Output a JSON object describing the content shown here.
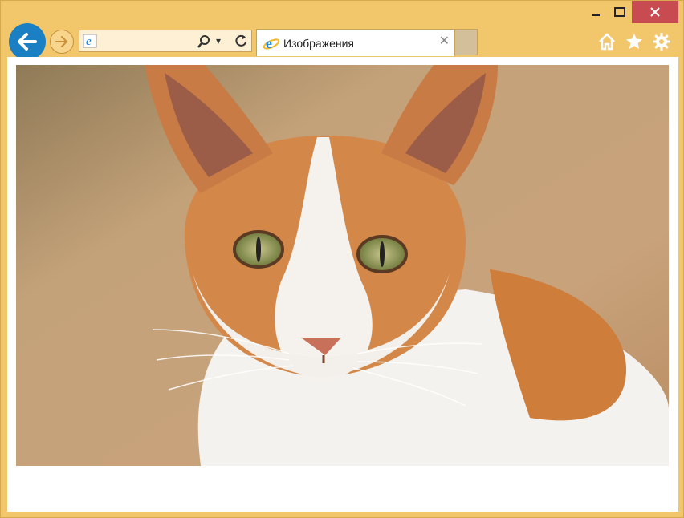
{
  "window": {
    "caption_buttons": [
      "minimize-icon",
      "maximize-icon",
      "close-icon"
    ],
    "accent": "#f2c66b",
    "close_color": "#c74b50"
  },
  "toolbar": {
    "back_icon": "arrow-left-icon",
    "forward_icon": "arrow-right-icon",
    "address": {
      "icon": "ie-logo-icon",
      "search_icon": "search-icon",
      "dropdown_glyph": "▾",
      "refresh_icon": "refresh-icon"
    }
  },
  "tab": {
    "icon": "ie-logo-icon",
    "title": "Изображения",
    "close_glyph": "✕"
  },
  "right_icons": [
    "home-icon",
    "star-icon",
    "gear-icon"
  ],
  "page": {
    "image": "cat-photo"
  }
}
